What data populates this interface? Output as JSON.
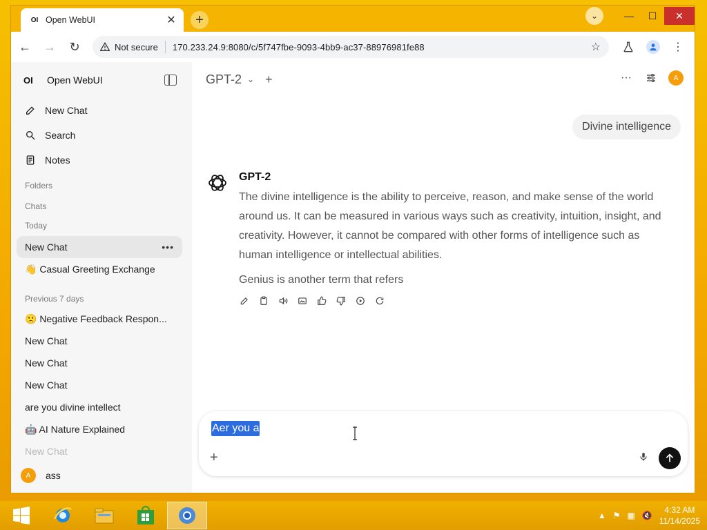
{
  "browser": {
    "tab_title": "Open WebUI",
    "favicon_text": "OI",
    "address": {
      "security_label": "Not secure",
      "url": "170.233.24.9:8080/c/5f747fbe-9093-4bb9-ac37-88976981fe88"
    }
  },
  "sidebar": {
    "logo_text": "OI",
    "app_name": "Open WebUI",
    "nav": [
      {
        "label": "New Chat",
        "icon": "edit-icon"
      },
      {
        "label": "Search",
        "icon": "search-icon"
      },
      {
        "label": "Notes",
        "icon": "notes-icon"
      }
    ],
    "folders_label": "Folders",
    "chats_label": "Chats",
    "today_label": "Today",
    "today_chats": [
      {
        "label": "New Chat"
      },
      {
        "label": "👋 Casual Greeting Exchange"
      }
    ],
    "prev7_label": "Previous 7 days",
    "prev_chats": [
      {
        "label": "🙁 Negative Feedback Respon..."
      },
      {
        "label": "New Chat"
      },
      {
        "label": "New Chat"
      },
      {
        "label": "New Chat"
      },
      {
        "label": "are you divine intellect"
      },
      {
        "label": "🤖 AI Nature Explained"
      },
      {
        "label": "New Chat"
      }
    ],
    "user": {
      "initial": "A",
      "name": "ass"
    }
  },
  "main": {
    "model_name": "GPT-2",
    "user_message": "Divine intelligence",
    "assistant": {
      "name": "GPT-2",
      "paragraph1": "The divine intelligence is the ability to perceive, reason, and make sense of the world around us. It can be measured in various ways such as creativity, intuition, insight, and creativity. However, it cannot be compared with other forms of intelligence such as human intelligence or intellectual abilities.",
      "paragraph2": "Genius is another term that refers"
    },
    "composer": {
      "text": "Aer you a"
    },
    "avatar_initial": "A"
  },
  "taskbar": {
    "time": "4:32 AM",
    "date": "11/14/2025"
  },
  "colors": {
    "desktop": "#f5b400",
    "avatar": "#f59e0b",
    "selection": "#2b6de0",
    "close_button": "#c9302c"
  }
}
